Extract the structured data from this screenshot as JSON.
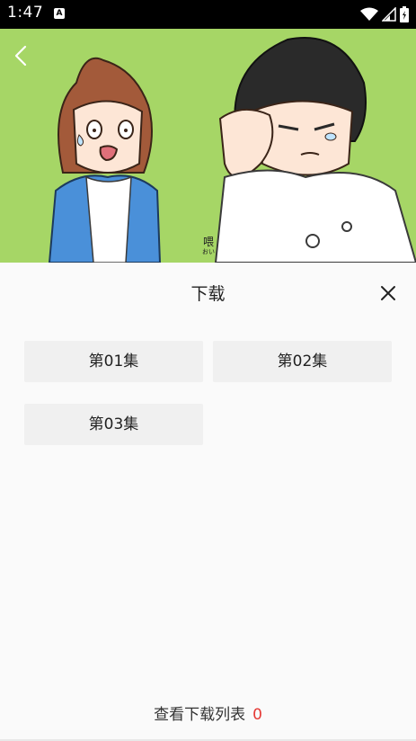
{
  "status_bar": {
    "time": "1:47",
    "notification_badge": "A",
    "icons": [
      "wifi-icon",
      "signal-icon",
      "battery-icon"
    ]
  },
  "video": {
    "caption_main": "喂",
    "caption_sub": "おい",
    "background_color": "#a6d666"
  },
  "sheet": {
    "title": "下载",
    "episodes": [
      {
        "label": "第01集"
      },
      {
        "label": "第02集"
      },
      {
        "label": "第03集"
      }
    ],
    "footer": {
      "label": "查看下载列表",
      "count": "0"
    }
  },
  "colors": {
    "accent_count": "#e53935",
    "episode_bg": "#f0f0f0",
    "sheet_bg": "#fafafa"
  }
}
